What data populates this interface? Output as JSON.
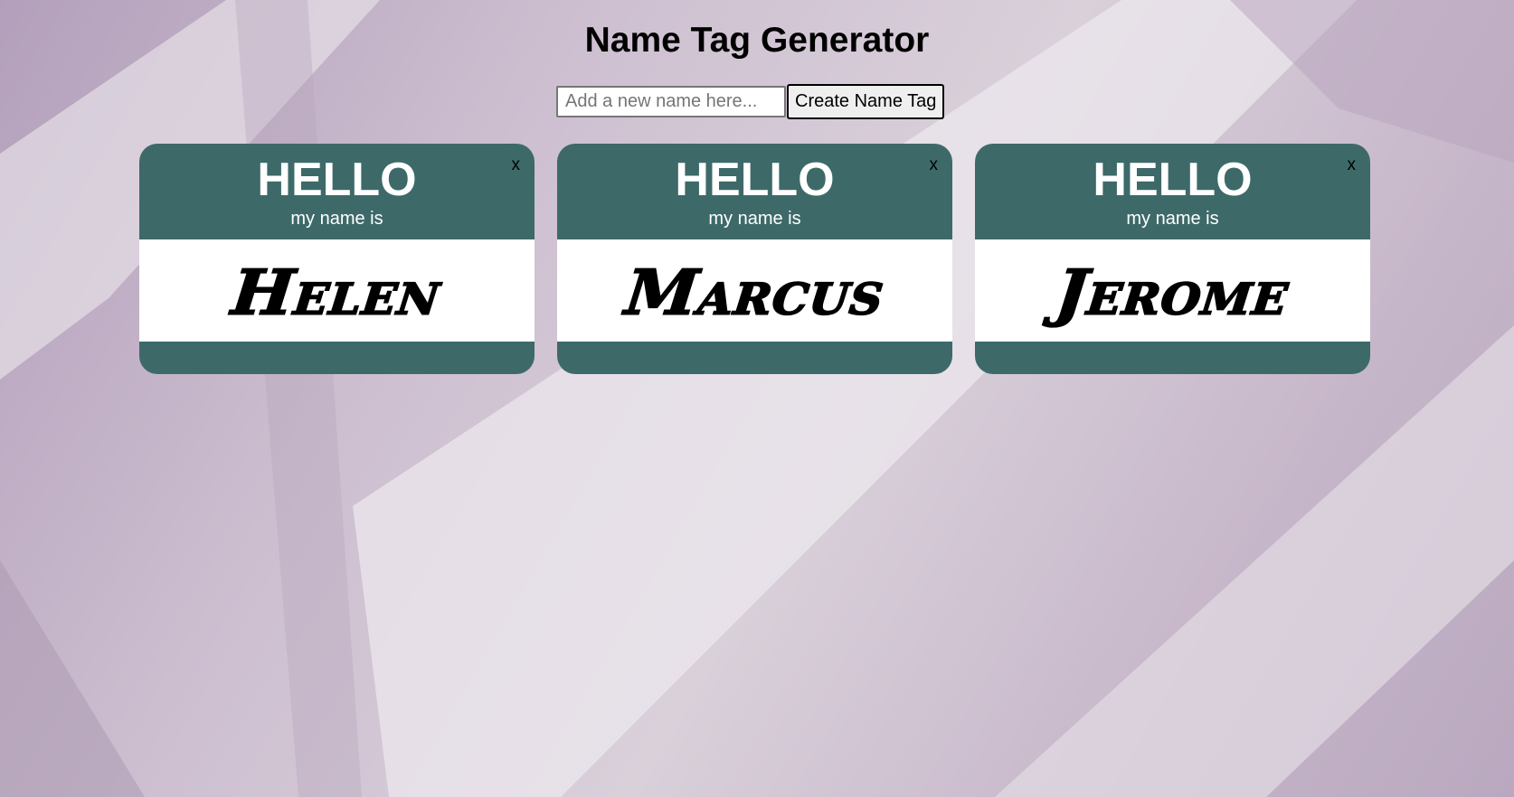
{
  "page": {
    "title": "Name Tag Generator"
  },
  "form": {
    "input_value": "",
    "input_placeholder": "Add a new name here...",
    "button_label": "Create Name Tag"
  },
  "tags": [
    {
      "greeting": "HELLO",
      "subtitle": "my name is",
      "name": "Helen",
      "close_label": "x"
    },
    {
      "greeting": "HELLO",
      "subtitle": "my name is",
      "name": "Marcus",
      "close_label": "x"
    },
    {
      "greeting": "HELLO",
      "subtitle": "my name is",
      "name": "Jerome",
      "close_label": "x"
    }
  ],
  "colors": {
    "tag_green": "#3d6a69",
    "background_lavender": "#c9bccb"
  }
}
